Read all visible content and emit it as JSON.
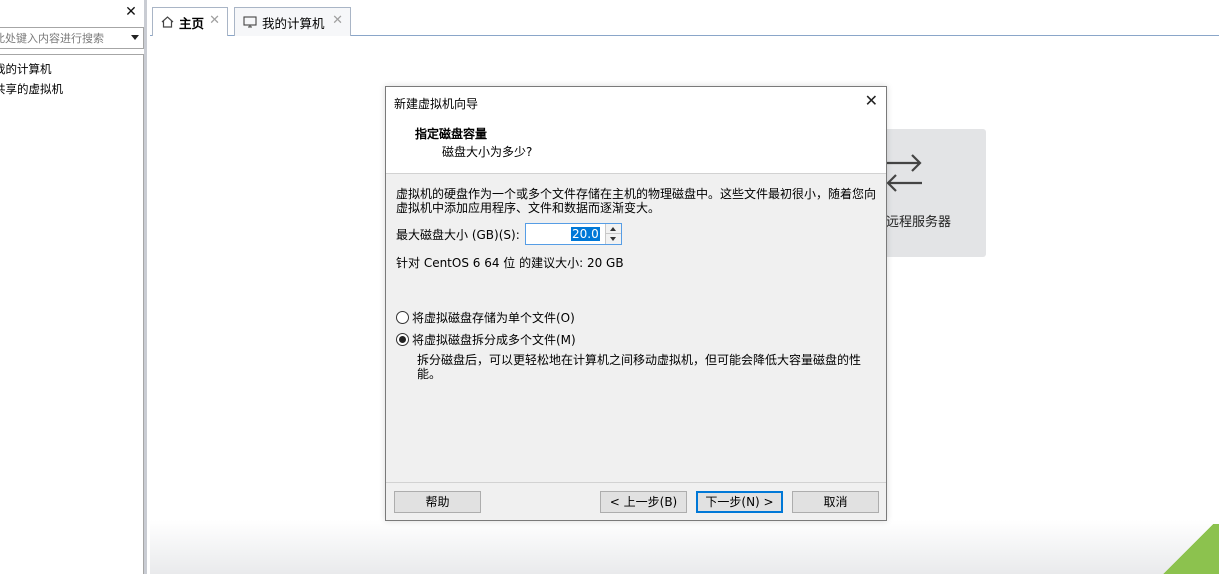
{
  "sidebar": {
    "search_placeholder": "此处键入内容进行搜索",
    "items": [
      {
        "label": "我的计算机"
      },
      {
        "label": "共享的虚拟机"
      }
    ]
  },
  "tabs": [
    {
      "label": "主页",
      "icon": "home-icon"
    },
    {
      "label": "我的计算机",
      "icon": "monitor-icon"
    }
  ],
  "home": {
    "remote_label": "远程服务器",
    "remote_icon": "swap-arrows-icon"
  },
  "dialog": {
    "title": "新建虚拟机向导",
    "heading": "指定磁盘容量",
    "subheading": "磁盘大小为多少?",
    "description": "虚拟机的硬盘作为一个或多个文件存储在主机的物理磁盘中。这些文件最初很小，随着您向虚拟机中添加应用程序、文件和数据而逐渐变大。",
    "size_label": "最大磁盘大小 (GB)(S):",
    "size_value": "20.0",
    "recommendation": "针对 CentOS 6 64 位 的建议大小: 20 GB",
    "options": [
      {
        "label": "将虚拟磁盘存储为单个文件(O)",
        "checked": false
      },
      {
        "label": "将虚拟磁盘拆分成多个文件(M)",
        "checked": true
      }
    ],
    "split_description": "拆分磁盘后，可以更轻松地在计算机之间移动虚拟机，但可能会降低大容量磁盘的性能。",
    "buttons": {
      "help": "帮助",
      "back": "< 上一步(B)",
      "next": "下一步(N) >",
      "cancel": "取消"
    }
  }
}
